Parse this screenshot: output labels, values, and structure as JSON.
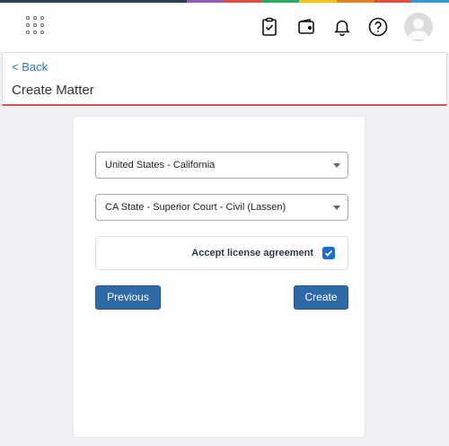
{
  "theme": {
    "rainbow": [
      "#2c3e50",
      "#2c3e50",
      "#2c3e50",
      "#2c3e50",
      "#2c3e50",
      "#9b59b6",
      "#e74c3c",
      "#27ae60",
      "#f1c40f",
      "#e67e22",
      "#e74c3c",
      "#3498db"
    ],
    "accent": "#2f6aa8",
    "danger_line": "#d9534f"
  },
  "topbar": {
    "icons": [
      "apps-grid-icon",
      "clipboard-check-icon",
      "wallet-icon",
      "bell-icon",
      "help-icon",
      "user-avatar-icon"
    ]
  },
  "header": {
    "back_label": "< Back",
    "title": "Create Matter"
  },
  "form": {
    "jurisdiction": {
      "value": "United States - California"
    },
    "court": {
      "value": "CA State - Superior Court - Civil (Lassen)"
    },
    "license": {
      "label": "Accept license agreement",
      "checked": true
    },
    "previous_label": "Previous",
    "create_label": "Create"
  }
}
